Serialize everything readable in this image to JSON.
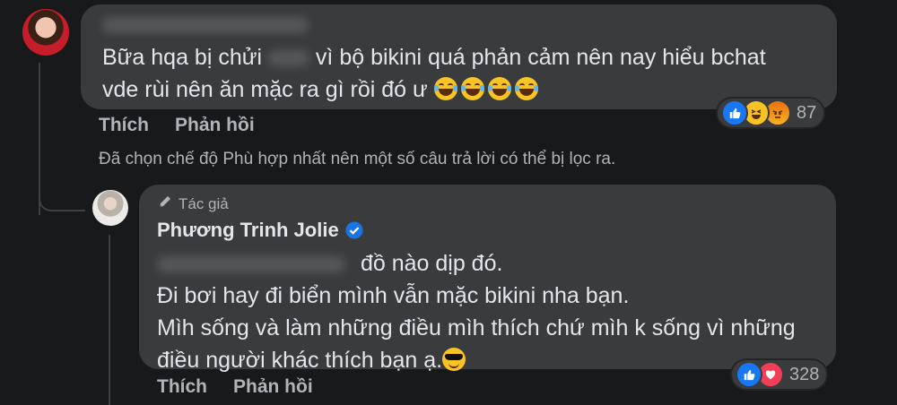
{
  "comment1": {
    "author_name_blurred": true,
    "text_line1_before": "Bữa hqa bị chửi",
    "text_line1_after": "vì bộ bikini quá phản cảm nên nay hiểu bchat",
    "text_line2": "vde rùi nên ăn mặc ra gì rồi đó ư",
    "emojis": [
      "laughing-tears",
      "laughing-tears",
      "laughing-tears",
      "laughing-tears"
    ],
    "like_label": "Thích",
    "reply_label": "Phản hồi",
    "reaction_count": "87",
    "reactions": [
      "like",
      "haha",
      "angry"
    ]
  },
  "filter_notice": "Đã chọn chế độ Phù hợp nhất nên một số câu trả lời có thể bị lọc ra.",
  "reply": {
    "badge": "Tác giả",
    "author_name": "Phương Trinh Jolie",
    "verified": true,
    "line1_after_mention": "đồ nào dịp đó.",
    "line2": "Đi bơi hay đi biển mình vẫn mặc bikini nha bạn.",
    "line3": "Mìh sống và làm những điều mìh thích chứ mìh k sống vì những",
    "line4": "điều người khác thích bạn ạ.",
    "emoji": "sunglasses",
    "like_label": "Thích",
    "reply_label": "Phản hồi",
    "reaction_count": "328",
    "reactions": [
      "like",
      "love"
    ]
  },
  "colors": {
    "background": "#18191a",
    "bubble": "#3a3b3c",
    "text": "#e4e6eb",
    "secondary": "#b0b3b8",
    "like_blue": "#1877f2",
    "love_red": "#f33e58",
    "verified_blue": "#1b74e4"
  }
}
